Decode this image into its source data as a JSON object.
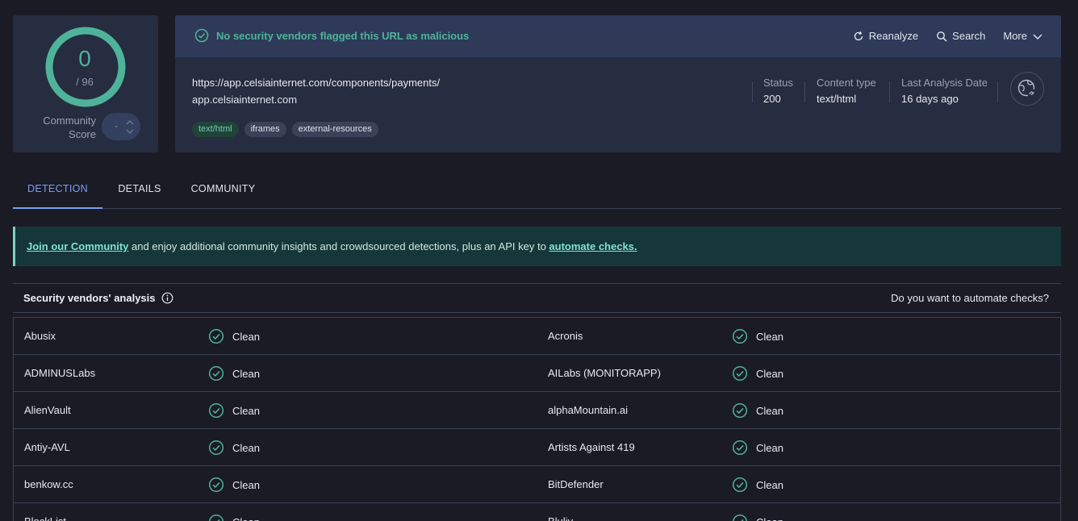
{
  "score": {
    "value": "0",
    "total": "/ 96",
    "community_line1": "Community",
    "community_line2": "Score",
    "ring_color": "#4fb39a"
  },
  "header": {
    "verdict": "No security vendors flagged this URL as malicious",
    "reanalyze": "Reanalyze",
    "search": "Search",
    "more": "More"
  },
  "target": {
    "url": "https://app.celsiainternet.com/components/payments/",
    "domain": "app.celsiainternet.com",
    "tags": [
      "text/html",
      "iframes",
      "external-resources"
    ]
  },
  "meta": {
    "status_label": "Status",
    "status_value": "200",
    "content_type_label": "Content type",
    "content_type_value": "text/html",
    "last_analysis_label": "Last Analysis Date",
    "last_analysis_value": "16 days ago"
  },
  "tabs": [
    "DETECTION",
    "DETAILS",
    "COMMUNITY"
  ],
  "banner": {
    "link1": "Join our Community",
    "text": " and enjoy additional community insights and crowdsourced detections, plus an API key to ",
    "link2": "automate checks."
  },
  "vendors_head": {
    "title": "Security vendors' analysis",
    "right": "Do you want to automate checks?"
  },
  "vendors": [
    [
      {
        "name": "Abusix",
        "result": "Clean"
      },
      {
        "name": "Acronis",
        "result": "Clean"
      }
    ],
    [
      {
        "name": "ADMINUSLabs",
        "result": "Clean"
      },
      {
        "name": "AILabs (MONITORAPP)",
        "result": "Clean"
      }
    ],
    [
      {
        "name": "AlienVault",
        "result": "Clean"
      },
      {
        "name": "alphaMountain.ai",
        "result": "Clean"
      }
    ],
    [
      {
        "name": "Antiy-AVL",
        "result": "Clean"
      },
      {
        "name": "Artists Against 419",
        "result": "Clean"
      }
    ],
    [
      {
        "name": "benkow.cc",
        "result": "Clean"
      },
      {
        "name": "BitDefender",
        "result": "Clean"
      }
    ],
    [
      {
        "name": "BlockList",
        "result": "Clean"
      },
      {
        "name": "Bluliv",
        "result": "Clean"
      }
    ]
  ],
  "colors": {
    "accent": "#7a9ef0",
    "clean": "#4fb39a"
  }
}
